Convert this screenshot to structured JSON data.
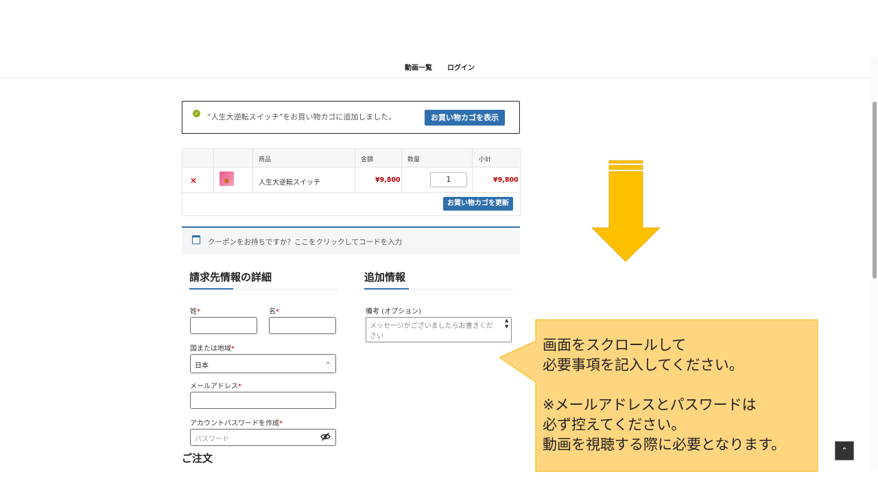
{
  "nav": {
    "items": [
      "動画一覧",
      "ログイン"
    ]
  },
  "notice": {
    "message": "“人生大逆転スイッチ”をお買い物カゴに追加しました。",
    "view_cart_label": "お買い物カゴを表示"
  },
  "cart": {
    "headers": [
      "",
      "",
      "商品",
      "金額",
      "数量",
      "小計"
    ],
    "rows": [
      {
        "remove": "×",
        "product": "人生大逆転スイッチ",
        "price": "¥9,800",
        "quantity": "1",
        "subtotal": "¥9,800"
      }
    ],
    "update_label": "お買い物カゴを更新"
  },
  "coupon": {
    "text": "クーポンをお持ちですか？ここをクリックしてコードを入力"
  },
  "billing": {
    "title": "請求先情報の詳細",
    "last_name_label": "姓",
    "first_name_label": "名",
    "required_mark": "*",
    "country_label": "国または地域",
    "country_value": "日本",
    "email_label": "メールアドレス",
    "password_label": "アカウントパスワードを作成",
    "password_placeholder": "パスワード"
  },
  "additional": {
    "title": "追加情報",
    "notes_label": "備考 (オプション)",
    "notes_placeholder": "メッセージがございましたらお書きください"
  },
  "order": {
    "title": "ご注文"
  },
  "callout": {
    "text": "画面をスクロールして\n必要事項を記入してください。\n\n※メールアドレスとパスワードは\n必ず控えてください。\n動画を視聴する際に必要となります。"
  },
  "colors": {
    "accent": "#2f6fad",
    "price": "#b10000",
    "arrow": "#ffc000",
    "callout_fill": "#ffd57f",
    "callout_border": "#f0b400"
  },
  "icons": {
    "success": "check-circle-icon",
    "coupon": "coupon-icon",
    "password": "eye-slash-icon",
    "back_to_top": "chevron-up-icon"
  }
}
